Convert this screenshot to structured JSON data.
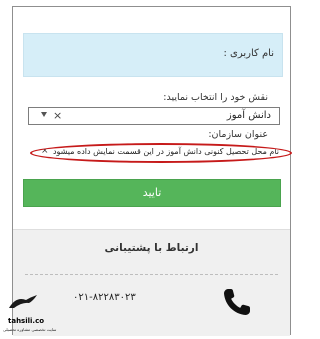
{
  "login_form": {
    "username_label": "نام کاربری :",
    "role_label": "نقش خود را انتخاب نمایید:",
    "role_selected": "دانش آموز",
    "role_clear": "×",
    "org_label": "عنوان سازمان:",
    "org_placeholder": "نام محل تحصیل کنونی دانش آموز در این قسمت نمایش داده میشود",
    "org_clear": "×",
    "submit_label": "تایید"
  },
  "support": {
    "title": "ارتباط با پشتیبانی",
    "phone": "۰۲۱-۸۲۲۸۳۰۲۳",
    "icon": "phone-icon"
  },
  "watermark": {
    "brand_name": "tahsili.co",
    "logo_text": "تحصیلی",
    "subtitle": "سایت تخصصی مشاوره تحصیلی"
  },
  "colors": {
    "username_bg": "#d6eef8",
    "submit_bg": "#55b55a",
    "highlight_border": "#c61a1a",
    "support_bg": "#f0f0f0"
  }
}
